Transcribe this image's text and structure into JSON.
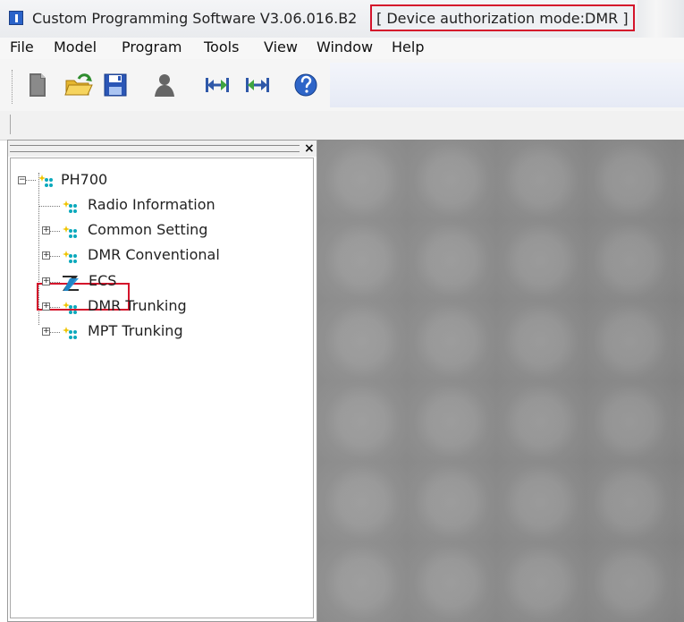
{
  "window": {
    "title": "Custom Programming Software V3.06.016.B2",
    "mode_label": "[ Device authorization mode:DMR ]"
  },
  "menus": [
    "File",
    "Model",
    "Program",
    "Tools",
    "View",
    "Window",
    "Help"
  ],
  "toolbar": {
    "icons": [
      "new-file-icon",
      "open-folder-icon",
      "save-icon",
      "user-icon",
      "read-radio-icon",
      "write-radio-icon",
      "help-icon"
    ]
  },
  "tree": {
    "root": "PH700",
    "items": [
      {
        "label": "Radio Information",
        "expandable": false
      },
      {
        "label": "Common Setting",
        "expandable": true
      },
      {
        "label": "DMR Conventional",
        "expandable": true
      },
      {
        "label": "ECS",
        "expandable": true
      },
      {
        "label": "DMR Trunking",
        "expandable": true
      },
      {
        "label": "MPT Trunking",
        "expandable": true
      }
    ]
  },
  "colors": {
    "highlight": "#d4142b",
    "workspace": "#8f8f8f",
    "ecs_icon": "#1e8fd7"
  }
}
